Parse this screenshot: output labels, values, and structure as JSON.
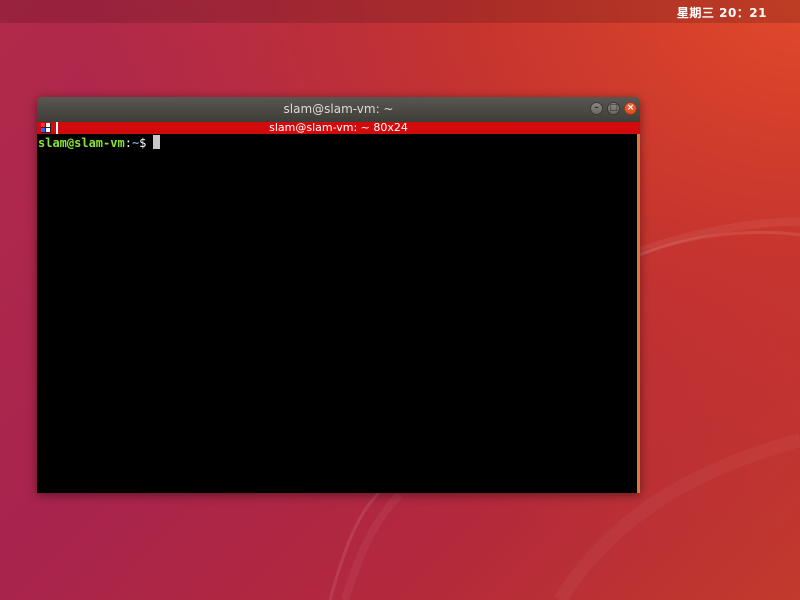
{
  "topbar": {
    "clock": "星期三 20：21"
  },
  "window": {
    "title": "slam@slam-vm: ~",
    "buttons": {
      "minimize_icon": "minimize-icon",
      "maximize_icon": "maximize-icon",
      "close_icon": "close-icon"
    }
  },
  "tab": {
    "icon": "terminal-multiplexer-icon",
    "title": "slam@slam-vm: ~ 80x24",
    "color": "#d10b0b"
  },
  "terminal": {
    "prompt": {
      "user_host": "slam@slam-vm",
      "separator": ":",
      "path": "~",
      "symbol": "$"
    },
    "background": "#000000",
    "user_color": "#8ae234",
    "path_color": "#729fcf"
  }
}
